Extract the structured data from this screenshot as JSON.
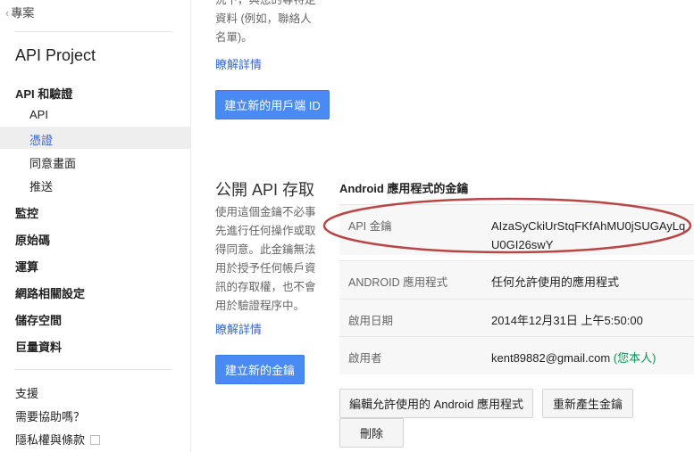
{
  "sidebar": {
    "back_label": "專案",
    "project_name": "API Project",
    "section_label": "API 和驗證",
    "sub_items": [
      "API",
      "憑證",
      "同意畫面",
      "推送"
    ],
    "items": [
      "監控",
      "原始碼",
      "運算",
      "網路相關設定",
      "儲存空間",
      "巨量資料"
    ],
    "footer": [
      "支援",
      "需要協助嗎？",
      "隱私權與條款"
    ]
  },
  "top_section": {
    "desc_lines": [
      "況下，與您的專特定",
      "資料 (例如，聯絡人",
      "名單)。"
    ],
    "learn_more": "瞭解詳情",
    "create_button": "建立新的用戶端 ID"
  },
  "public_api": {
    "title": "公開 API 存取",
    "desc_lines": [
      "使用這個金鑰不必事",
      "先進行任何操作或取",
      "得同意。此金鑰無法",
      "用於授予任何帳戶資",
      "訊的存取權，也不會",
      "用於驗證程序中。"
    ],
    "learn_more": "瞭解詳情",
    "create_button": "建立新的金鑰"
  },
  "key_table": {
    "title": "Android 應用程式的金鑰",
    "api_key_label": "API 金鑰",
    "api_key_line1": "AIzaSyCkiUrStqFKfAhMU0jSUGAyLq",
    "api_key_line2": "U0GI26swY",
    "android_label": "ANDROID 應用程式",
    "android_value": "任何允許使用的應用程式",
    "date_label": "啟用日期",
    "date_value": "2014年12月31日 上午5:50:00",
    "user_label": "啟用者",
    "user_email": "kent89882@gmail.com",
    "user_you": "(您本人)"
  },
  "actions": {
    "edit_button": "編輯允許使用的 Android 應用程式",
    "regen_button": "重新產生金鑰",
    "delete_button": "刪除"
  },
  "colors": {
    "accent": "#4a8af4",
    "link": "#3367d6",
    "highlight_ellipse": "#b94545",
    "you_green": "#0d904f"
  }
}
